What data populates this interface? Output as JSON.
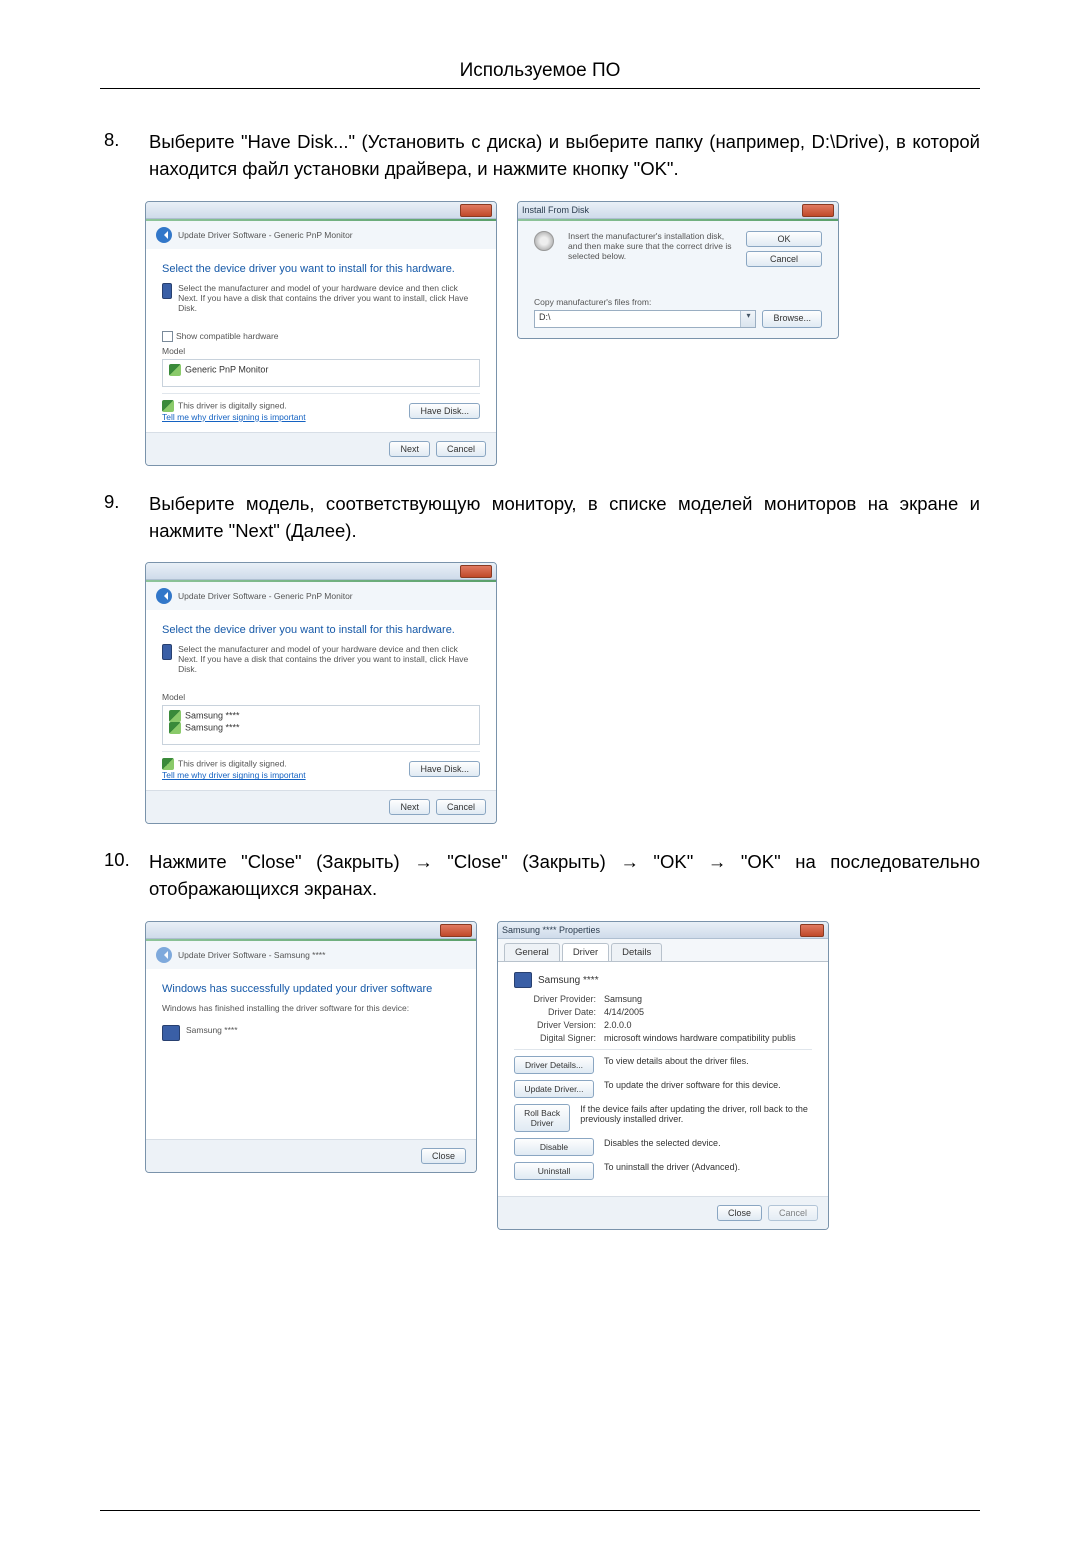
{
  "page": {
    "title": "Используемое ПО"
  },
  "steps": {
    "s8": {
      "num": "8.",
      "text": "Выберите \"Have Disk...\" (Установить с диска) и выберите папку (например, D:\\Drive), в которой находится файл установки драйвера, и нажмите кнопку \"OK\"."
    },
    "s9": {
      "num": "9.",
      "text": "Выберите модель, соответствующую монитору, в списке моделей мониторов на экране и нажмите \"Next\" (Далее)."
    },
    "s10": {
      "num": "10.",
      "text": "Нажмите \"Close\" (Закрыть) → \"Close\" (Закрыть) → \"OK\" → \"OK\" на последовательно отображающихся экранах."
    }
  },
  "dlg_driver_select": {
    "breadcrumb": "Update Driver Software - Generic PnP Monitor",
    "heading": "Select the device driver you want to install for this hardware.",
    "hint": "Select the manufacturer and model of your hardware device and then click Next. If you have a disk that contains the driver you want to install, click Have Disk.",
    "show_compat": "Show compatible hardware",
    "model_label": "Model",
    "model_item": "Generic PnP Monitor",
    "signed": "This driver is digitally signed.",
    "tell_me": "Tell me why driver signing is important",
    "have_disk": "Have Disk...",
    "next": "Next",
    "cancel": "Cancel"
  },
  "dlg_install_disk": {
    "title": "Install From Disk",
    "msg": "Insert the manufacturer's installation disk, and then make sure that the correct drive is selected below.",
    "ok": "OK",
    "cancel": "Cancel",
    "copy_label": "Copy manufacturer's files from:",
    "path": "D:\\",
    "browse": "Browse..."
  },
  "dlg_model_select": {
    "breadcrumb": "Update Driver Software - Generic PnP Monitor",
    "heading": "Select the device driver you want to install for this hardware.",
    "hint": "Select the manufacturer and model of your hardware device and then click Next. If you have a disk that contains the driver you want to install, click Have Disk.",
    "model_label": "Model",
    "model1": "Samsung ****",
    "model2": "Samsung ****",
    "signed": "This driver is digitally signed.",
    "tell_me": "Tell me why driver signing is important",
    "have_disk": "Have Disk...",
    "next": "Next",
    "cancel": "Cancel"
  },
  "dlg_success": {
    "breadcrumb": "Update Driver Software - Samsung ****",
    "heading": "Windows has successfully updated your driver software",
    "sub": "Windows has finished installing the driver software for this device:",
    "device": "Samsung ****",
    "close": "Close"
  },
  "dlg_props": {
    "title": "Samsung **** Properties",
    "tab_general": "General",
    "tab_driver": "Driver",
    "tab_details": "Details",
    "device": "Samsung ****",
    "provider_lbl": "Driver Provider:",
    "provider_val": "Samsung",
    "date_lbl": "Driver Date:",
    "date_val": "4/14/2005",
    "version_lbl": "Driver Version:",
    "version_val": "2.0.0.0",
    "signer_lbl": "Digital Signer:",
    "signer_val": "microsoft windows hardware compatibility publis",
    "btn_details": "Driver Details...",
    "btn_details_desc": "To view details about the driver files.",
    "btn_update": "Update Driver...",
    "btn_update_desc": "To update the driver software for this device.",
    "btn_rollback": "Roll Back Driver",
    "btn_rollback_desc": "If the device fails after updating the driver, roll back to the previously installed driver.",
    "btn_disable": "Disable",
    "btn_disable_desc": "Disables the selected device.",
    "btn_uninstall": "Uninstall",
    "btn_uninstall_desc": "To uninstall the driver (Advanced).",
    "close": "Close",
    "cancel": "Cancel"
  }
}
